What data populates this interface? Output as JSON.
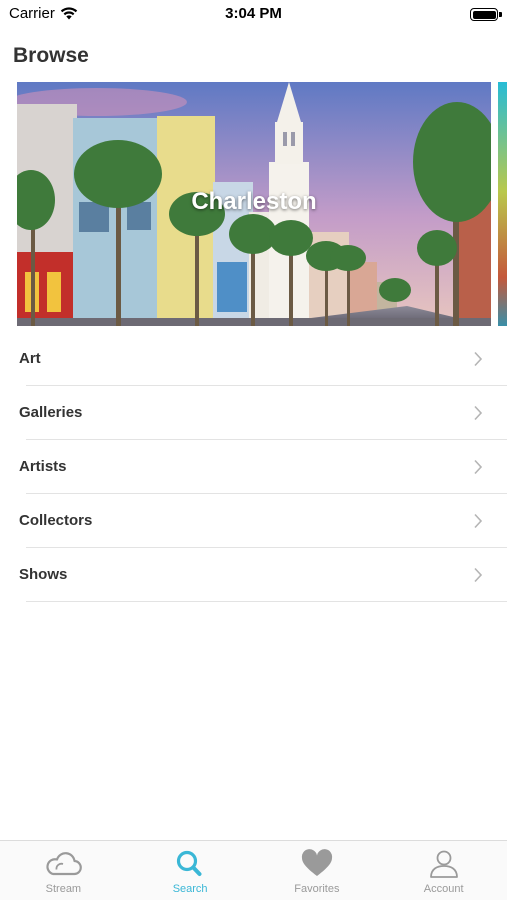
{
  "status_bar": {
    "carrier": "Carrier",
    "time": "3:04 PM"
  },
  "page": {
    "title": "Browse"
  },
  "hero": {
    "caption": "Charleston"
  },
  "browse_items": [
    {
      "label": "Art"
    },
    {
      "label": "Galleries"
    },
    {
      "label": "Artists"
    },
    {
      "label": "Collectors"
    },
    {
      "label": "Shows"
    }
  ],
  "tab_bar": {
    "active": "Search",
    "accent_color": "#3ab7d6",
    "inactive_color": "#9a9a9a",
    "tabs": [
      {
        "label": "Stream",
        "icon": "cloud-icon"
      },
      {
        "label": "Search",
        "icon": "search-icon"
      },
      {
        "label": "Favorites",
        "icon": "heart-icon"
      },
      {
        "label": "Account",
        "icon": "person-icon"
      }
    ]
  }
}
